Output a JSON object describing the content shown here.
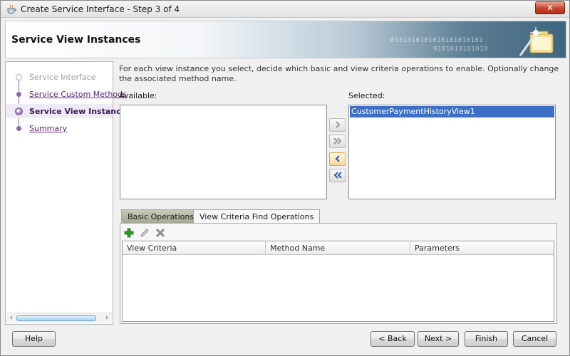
{
  "window": {
    "title": "Create Service Interface - Step 3 of 4",
    "close_label": "✕"
  },
  "banner": {
    "title": "Service View Instances",
    "binary_line_1": "0101010101010101010101",
    "binary_line_2": "0101010101010"
  },
  "nav": {
    "items": [
      {
        "label": "Service Interface",
        "state": "disabled"
      },
      {
        "label": "Service Custom Methods",
        "state": "link"
      },
      {
        "label": "Service View Instances",
        "state": "current"
      },
      {
        "label": "Summary",
        "state": "link"
      }
    ]
  },
  "main": {
    "instructions": "For each view instance you select, decide which basic and view criteria operations to enable. Optionally change the associated method name.",
    "available_label": "Available:",
    "selected_label": "Selected:",
    "available_items": [],
    "selected_items": [
      "CustomerPaymentHistoryView1"
    ],
    "shuttle": {
      "move_right": "›",
      "move_all_right": "»",
      "move_left": "‹",
      "move_all_left": "«"
    }
  },
  "tabs": [
    {
      "label": "Basic Operations",
      "active": false
    },
    {
      "label": "View Criteria Find Operations",
      "active": true
    }
  ],
  "table": {
    "columns": [
      "View Criteria",
      "Method Name",
      "Parameters"
    ],
    "rows": []
  },
  "buttons": {
    "help": "Help",
    "back": "< Back",
    "next": "Next >",
    "finish": "Finish",
    "cancel": "Cancel"
  },
  "colors": {
    "selection": "#3d6fc7",
    "train_accent": "#8f6aa6",
    "add_icon": "#2e9a2e"
  }
}
